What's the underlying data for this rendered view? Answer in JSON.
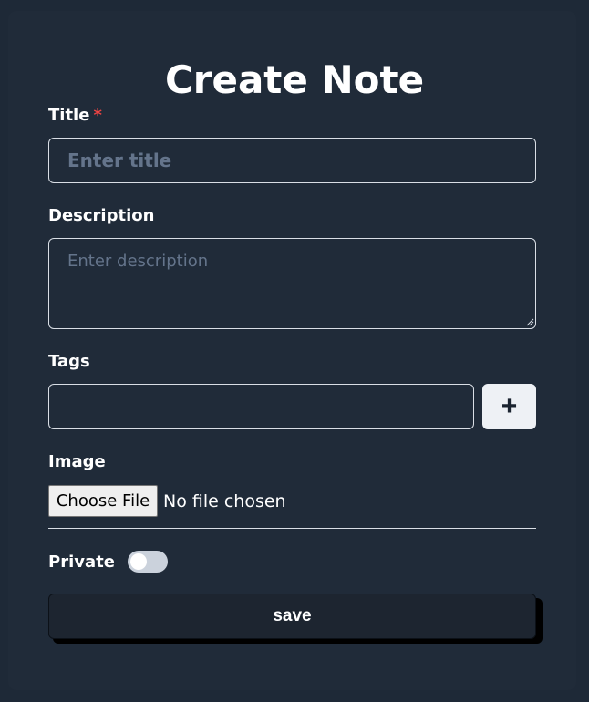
{
  "form": {
    "heading": "Create Note",
    "title_field": {
      "label": "Title",
      "required_marker": "*",
      "placeholder": "Enter title",
      "value": ""
    },
    "description_field": {
      "label": "Description",
      "placeholder": "Enter description",
      "value": ""
    },
    "tags_field": {
      "label": "Tags",
      "value": "",
      "add_button_label": "+"
    },
    "image_field": {
      "label": "Image",
      "choose_button_label": "Choose File",
      "status_text": "No file chosen"
    },
    "private_field": {
      "label": "Private",
      "enabled": false
    },
    "save_button_label": "save"
  },
  "colors": {
    "background": "#1e2937",
    "card": "#202b39",
    "required": "#ef4444",
    "toggle_off": "#cbd2dc",
    "save_button": "#1d2530"
  }
}
